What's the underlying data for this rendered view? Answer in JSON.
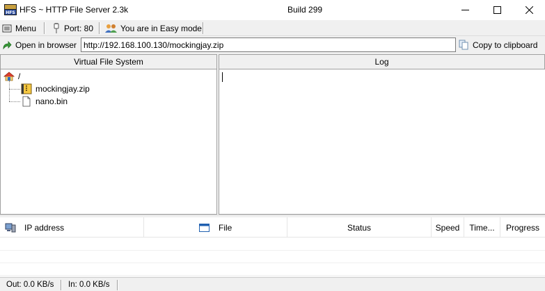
{
  "window": {
    "title": "HFS ~ HTTP File Server 2.3k",
    "build": "Build 299"
  },
  "toolbar": {
    "menu_label": "Menu",
    "port_label": "Port: 80",
    "mode_label": "You are in Easy mode"
  },
  "url_bar": {
    "open_browser_label": "Open in browser",
    "url_value": "http://192.168.100.130/mockingjay.zip",
    "copy_label": "Copy to clipboard"
  },
  "panels": {
    "vfs_title": "Virtual File System",
    "log_title": "Log"
  },
  "vfs_tree": {
    "root": "/",
    "items": [
      {
        "name": "mockingjay.zip",
        "icon": "zip-archive-icon"
      },
      {
        "name": "nano.bin",
        "icon": "file-icon"
      }
    ]
  },
  "connections": {
    "columns": [
      "IP address",
      "File",
      "Status",
      "Speed",
      "Time...",
      "Progress"
    ]
  },
  "status_bar": {
    "out": "Out: 0.0 KB/s",
    "in": "In: 0.0 KB/s"
  }
}
